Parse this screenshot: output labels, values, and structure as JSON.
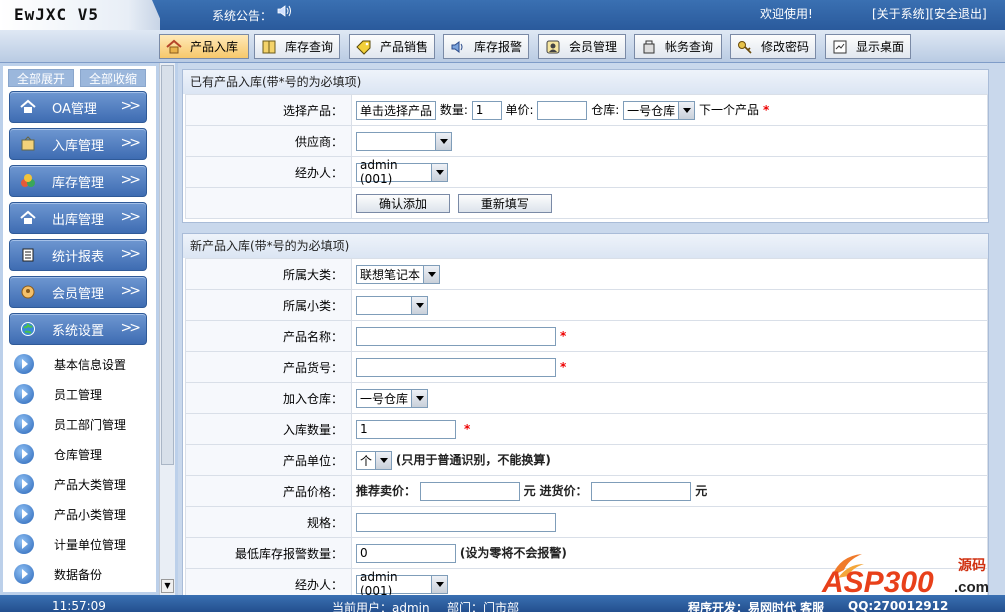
{
  "app": {
    "title": "EwJXC V5"
  },
  "header": {
    "notice_label": "系统公告：",
    "welcome": "欢迎使用!",
    "about": "[关于系统]",
    "logout": "[安全退出]"
  },
  "tabs": [
    {
      "label": "产品入库",
      "icon": "house-icon"
    },
    {
      "label": "库存查询",
      "icon": "book-icon"
    },
    {
      "label": "产品销售",
      "icon": "tag-icon"
    },
    {
      "label": "库存报警",
      "icon": "speaker-icon"
    },
    {
      "label": "会员管理",
      "icon": "member-icon"
    },
    {
      "label": "帐务查询",
      "icon": "box-icon"
    },
    {
      "label": "修改密码",
      "icon": "key-icon"
    },
    {
      "label": "显示桌面",
      "icon": "desktop-icon"
    }
  ],
  "sidebar": {
    "expand_all": "全部展开",
    "collapse_all": "全部收缩",
    "menus": [
      "OA管理",
      "入库管理",
      "库存管理",
      "出库管理",
      "统计报表",
      "会员管理",
      "系统设置"
    ],
    "sub_items": [
      "基本信息设置",
      "员工管理",
      "员工部门管理",
      "仓库管理",
      "产品大类管理",
      "产品小类管理",
      "计量单位管理",
      "数据备份"
    ]
  },
  "existing": {
    "title": "已有产品入库(带*号的为必填项)",
    "select_product_label": "选择产品：",
    "select_product_btn": "单击选择产品",
    "qty_label": "数量:",
    "qty_value": "1",
    "price_label": "单价:",
    "price_value": "",
    "warehouse_label": "仓库:",
    "warehouse_value": "一号仓库",
    "next_label": "下一个产品",
    "supplier_label": "供应商：",
    "supplier_value": "",
    "handler_label": "经办人：",
    "handler_value": "admin (001)",
    "confirm_btn": "确认添加",
    "reset_btn": "重新填写"
  },
  "new_product": {
    "title": "新产品入库(带*号的为必填项)",
    "category_label": "所属大类：",
    "category_value": "联想笔记本",
    "subcategory_label": "所属小类：",
    "subcategory_value": "",
    "name_label": "产品名称：",
    "name_value": "",
    "code_label": "产品货号：",
    "code_value": "",
    "warehouse_label": "加入仓库：",
    "warehouse_value": "一号仓库",
    "qty_label": "入库数量：",
    "qty_value": "1",
    "unit_label": "产品单位：",
    "unit_value": "个",
    "unit_note": "(只用于普通识别，不能换算)",
    "price_label": "产品价格：",
    "sale_price_label": "推荐卖价：",
    "sale_price_value": "",
    "yuan": "元",
    "cost_price_label": "进货价：",
    "cost_price_value": "",
    "spec_label": "规格：",
    "spec_value": "",
    "min_stock_label": "最低库存报警数量：",
    "min_stock_value": "0",
    "min_stock_note": "(设为零将不会报警)",
    "handler_label": "经办人：",
    "handler_value": "admin (001)"
  },
  "footer": {
    "time": "11:57:09",
    "current_user": "当前用户：admin",
    "department": "部门：门市部",
    "developer": "程序开发：易网时代 客服",
    "qq": "QQ:270012912"
  },
  "watermark": {
    "brand": "ASP300",
    "sub": "源码",
    "domain": ".com"
  }
}
